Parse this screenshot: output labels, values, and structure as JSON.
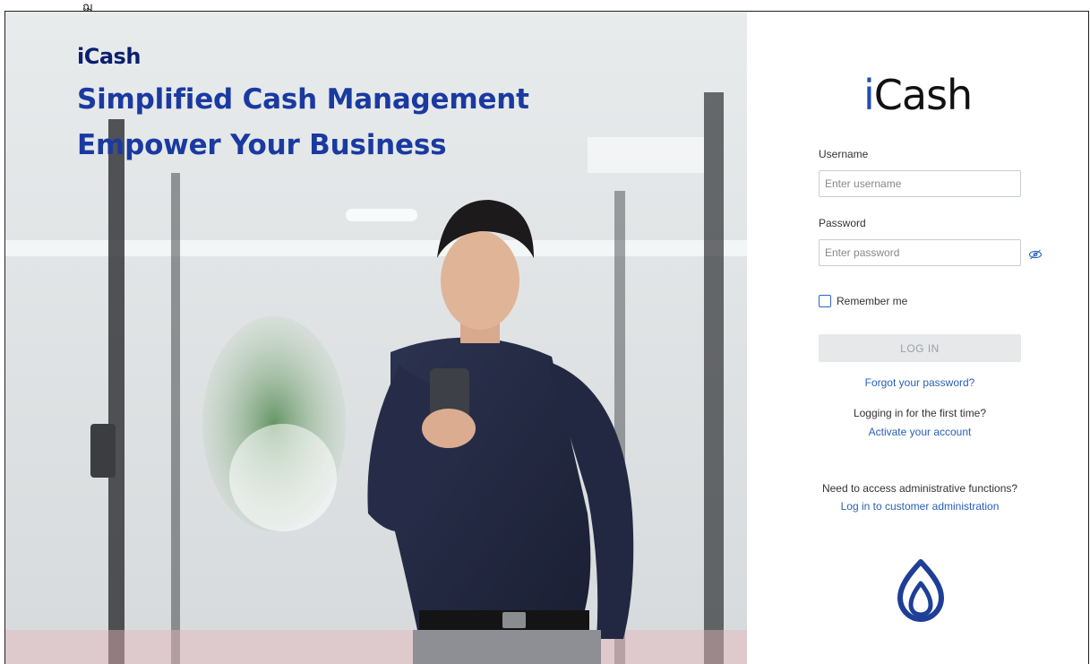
{
  "top_glyph": "ฌ",
  "hero": {
    "brand": {
      "i": "i",
      "rest": "Cash"
    },
    "headline_line1": "Simplified Cash Management",
    "headline_line2": "Empower Your Business"
  },
  "login": {
    "logo": {
      "i": "i",
      "rest": "Cash"
    },
    "username_label": "Username",
    "username_placeholder": "Enter username",
    "username_value": "",
    "password_label": "Password",
    "password_placeholder": "Enter password",
    "password_value": "",
    "password_toggle_icon": "eye-off-icon",
    "remember_label": "Remember me",
    "remember_checked": false,
    "login_button": "LOG IN",
    "forgot_link": "Forgot your password?",
    "first_time_text": "Logging in for the first time?",
    "activate_link": "Activate your account",
    "admin_text": "Need to access administrative functions?",
    "admin_link": "Log in to customer administration",
    "bank_logo_icon": "lotus-leaf-logo"
  },
  "colors": {
    "brand_navy": "#0b1f6e",
    "headline_blue": "#1a3aa0",
    "logo_i_blue": "#1f4fb5",
    "link_blue": "#2a5fb8",
    "button_disabled_bg": "#e7e8ea",
    "button_disabled_text": "#9aa0a6"
  }
}
